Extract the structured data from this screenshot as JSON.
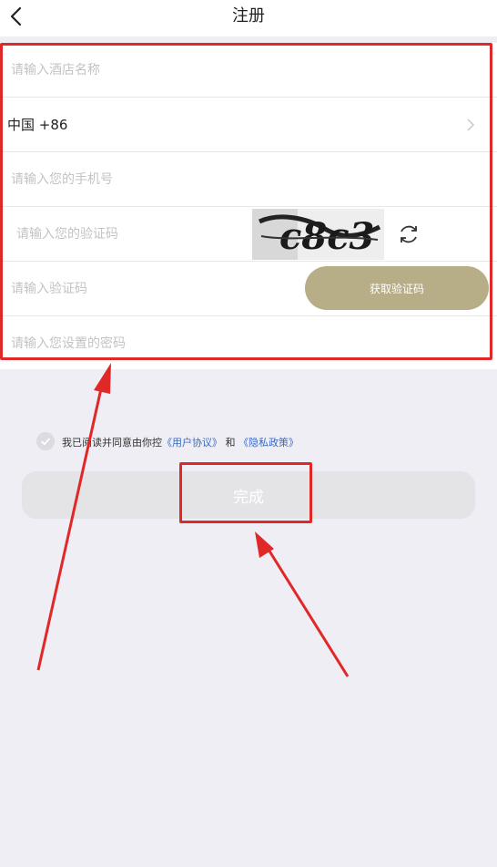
{
  "nav": {
    "title": "注册"
  },
  "form": {
    "hotel_name_placeholder": "请输入酒店名称",
    "country_label": "中国 +86",
    "phone_placeholder": "请输入您的手机号",
    "captcha_placeholder": "请输入您的验证码",
    "captcha_image_text": "c8c3",
    "sms_code_placeholder": "请输入验证码",
    "get_code_button": "获取验证码",
    "password_placeholder": "请输入您设置的密码"
  },
  "agreement": {
    "prefix": "我已阅读并同意由你控",
    "user_agreement": "《用户协议》",
    "and": "和",
    "privacy_policy": "《隐私政策》"
  },
  "submit": {
    "label": "完成"
  },
  "colors": {
    "background": "#efeef5",
    "get_code_button": "#b7ad86",
    "submit_disabled": "#e4e3e6",
    "annotation_red": "#e02828",
    "link": "#3a6bc4"
  }
}
